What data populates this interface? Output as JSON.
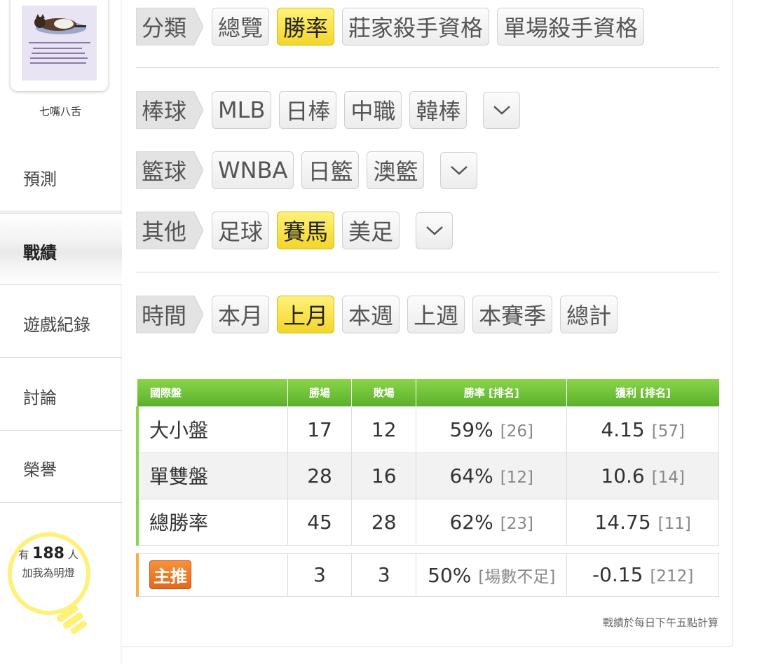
{
  "sidebar": {
    "username": "七嘴八舌",
    "nav": [
      "預測",
      "戰績",
      "遊戲紀錄",
      "討論",
      "榮譽"
    ],
    "fans": {
      "prefix": "有",
      "count": "188",
      "suffix": "人",
      "caption": "加我為明燈"
    }
  },
  "filters": {
    "category": {
      "tag": "分類",
      "options": [
        "總覽",
        "勝率",
        "莊家殺手資格",
        "單場殺手資格"
      ],
      "selected": "勝率"
    },
    "baseball": {
      "tag": "棒球",
      "options": [
        "MLB",
        "日棒",
        "中職",
        "韓棒"
      ]
    },
    "basketball": {
      "tag": "籃球",
      "options": [
        "WNBA",
        "日籃",
        "澳籃"
      ]
    },
    "other": {
      "tag": "其他",
      "options": [
        "足球",
        "賽馬",
        "美足"
      ],
      "selected": "賽馬"
    },
    "time": {
      "tag": "時間",
      "options": [
        "本月",
        "上月",
        "本週",
        "上週",
        "本賽季",
        "總計"
      ],
      "selected": "上月"
    }
  },
  "table": {
    "headers": [
      "國際盤",
      "勝場",
      "敗場",
      "勝率 [排名]",
      "獲利 [排名]"
    ],
    "rows": [
      {
        "label": "大小盤",
        "win": "17",
        "lose": "12",
        "rate": "59%",
        "rate_rank": "[26]",
        "profit": "4.15",
        "profit_rank": "[57]"
      },
      {
        "label": "單雙盤",
        "win": "28",
        "lose": "16",
        "rate": "64%",
        "rate_rank": "[12]",
        "profit": "10.6",
        "profit_rank": "[14]"
      },
      {
        "label": "總勝率",
        "win": "45",
        "lose": "28",
        "rate": "62%",
        "rate_rank": "[23]",
        "profit": "14.75",
        "profit_rank": "[11]"
      }
    ],
    "main_pick": {
      "label": "主推",
      "win": "3",
      "lose": "3",
      "rate": "50%",
      "rate_rank": "[場數不足]",
      "profit": "-0.15",
      "profit_rank": "[212]"
    }
  },
  "footnote": "戰績於每日下午五點計算",
  "colors": {
    "selected": "#f3d52a",
    "header_green": "#5bb02a",
    "pick_orange": "#e4671c"
  }
}
